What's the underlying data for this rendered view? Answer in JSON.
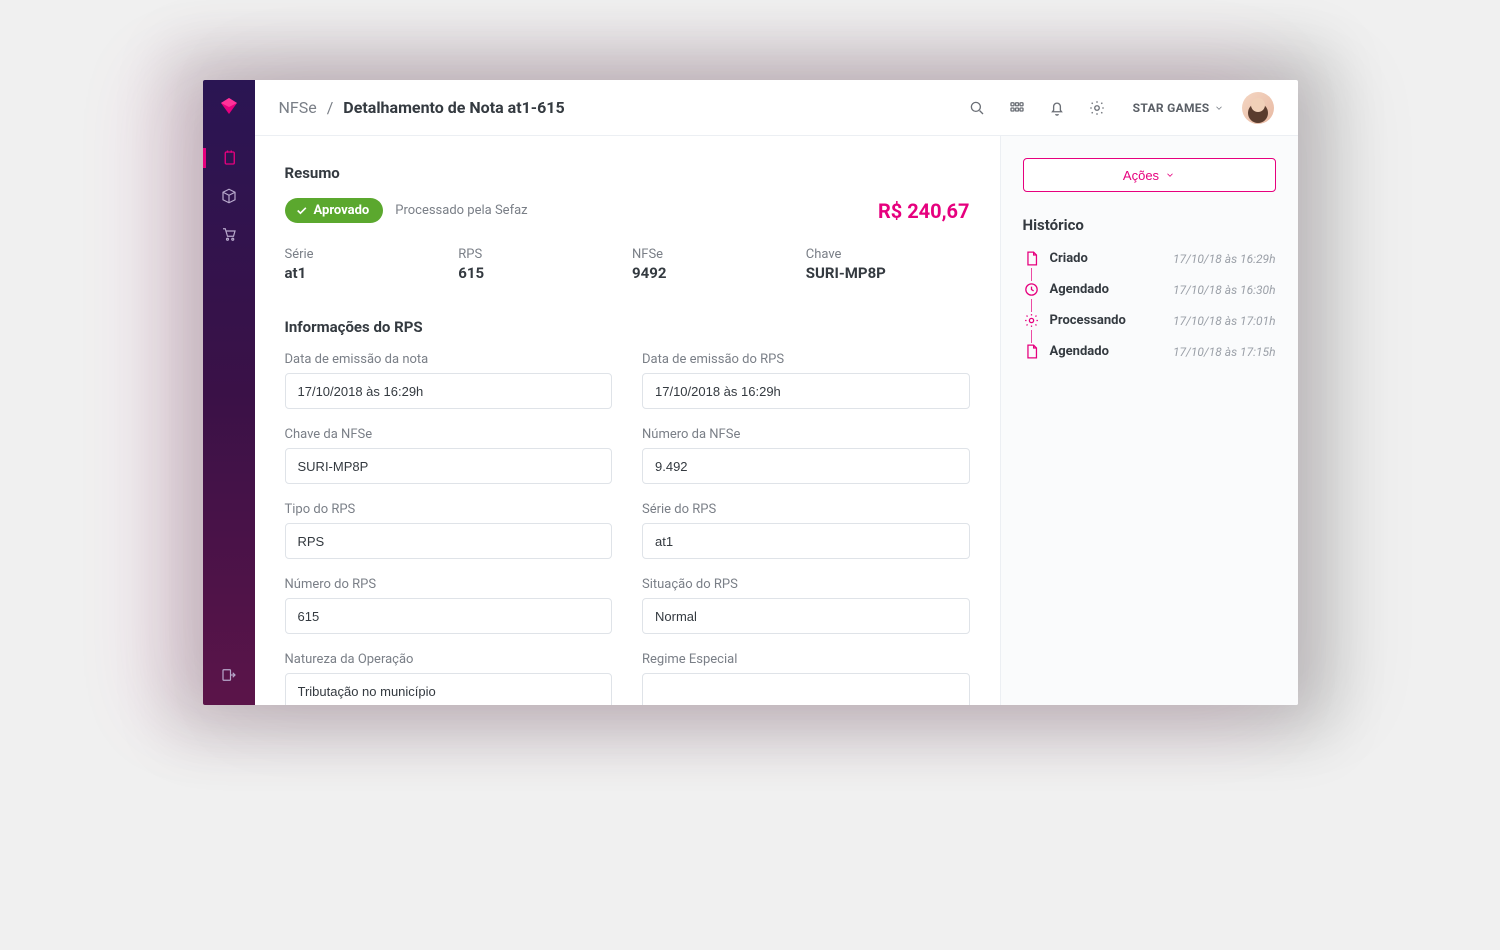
{
  "breadcrumb": {
    "root": "NFSe",
    "sep": "/",
    "current": "Detalhamento de Nota at1-615"
  },
  "user": {
    "label": "STAR GAMES"
  },
  "resumo": {
    "title": "Resumo",
    "badge": "Aprovado",
    "status_text": "Processado pela Sefaz",
    "amount": "R$ 240,67",
    "items": {
      "serie_label": "Série",
      "serie_value": "at1",
      "rps_label": "RPS",
      "rps_value": "615",
      "nfse_label": "NFSe",
      "nfse_value": "9492",
      "chave_label": "Chave",
      "chave_value": "SURI-MP8P"
    }
  },
  "rps_info": {
    "title": "Informações do RPS",
    "fields": {
      "emissao_nota_label": "Data de emissão da nota",
      "emissao_nota_value": "17/10/2018 às 16:29h",
      "emissao_rps_label": "Data de emissão do RPS",
      "emissao_rps_value": "17/10/2018 às 16:29h",
      "chave_nfse_label": "Chave da NFSe",
      "chave_nfse_value": "SURI-MP8P",
      "numero_nfse_label": "Número da NFSe",
      "numero_nfse_value": "9.492",
      "tipo_rps_label": "Tipo do RPS",
      "tipo_rps_value": "RPS",
      "serie_rps_label": "Série do RPS",
      "serie_rps_value": "at1",
      "numero_rps_label": "Número do RPS",
      "numero_rps_value": "615",
      "situacao_rps_label": "Situação do RPS",
      "situacao_rps_value": "Normal",
      "natureza_label": "Natureza da Operação",
      "natureza_value": "Tributação no município",
      "regime_label": "Regime Especial",
      "regime_value": ""
    }
  },
  "right": {
    "actions_label": "Ações",
    "historico_title": "Histórico",
    "history": [
      {
        "label": "Criado",
        "time": "17/10/18 às 16:29h",
        "icon": "file"
      },
      {
        "label": "Agendado",
        "time": "17/10/18 às 16:30h",
        "icon": "clock"
      },
      {
        "label": "Processando",
        "time": "17/10/18 às 17:01h",
        "icon": "gear"
      },
      {
        "label": "Agendado",
        "time": "17/10/18 às 17:15h",
        "icon": "file"
      }
    ]
  }
}
